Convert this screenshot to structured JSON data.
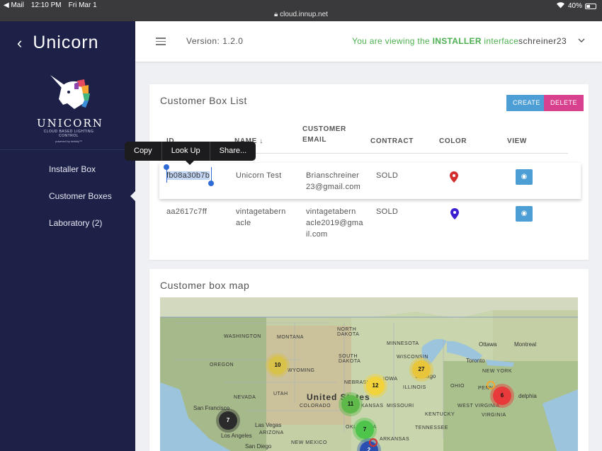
{
  "status_bar": {
    "back_app": "◀ Mail",
    "time": "12:10 PM",
    "date": "Fri Mar 1",
    "url": "cloud.innup.net",
    "battery": "40%",
    "battery_level": 0.4
  },
  "sidebar": {
    "app_name": "Unicorn",
    "logo_word": "UNICORN",
    "logo_tagline": "CLOUD BASED LIGHTING CONTROL",
    "logo_powered": "powered by twinkly™",
    "items": [
      {
        "label": "Installer Box"
      },
      {
        "label": "Customer Boxes"
      },
      {
        "label": "Laboratory (2)"
      }
    ]
  },
  "header": {
    "version": "Version: 1.2.0",
    "viewing_prefix": "You are viewing the ",
    "viewing_role": "INSTALLER",
    "viewing_suffix": " interface",
    "username": "schreiner23"
  },
  "box_list": {
    "title": "Customer Box List",
    "create_label": "CREATE",
    "delete_label": "DELETE",
    "columns": {
      "id": "ID",
      "name": "NAME",
      "email_line1": "CUSTOMER",
      "email_line2": "EMAIL",
      "contract": "CONTRACT",
      "color": "COLOR",
      "view": "VIEW"
    },
    "sort_icon": "arrow-down-icon",
    "rows": [
      {
        "id": "fb08a30b7b",
        "name": "Unicorn Test",
        "email_l1": "Brianschreiner",
        "email_l2": "23@gmail.com",
        "email_l3": "",
        "contract": "SOLD",
        "color": "#d32f2f"
      },
      {
        "id": "aa2617c7ff",
        "name": "vintagetabern",
        "name_l2": "acle",
        "email_l1": "vintagetabern",
        "email_l2": "acle2019@gma",
        "email_l3": "il.com",
        "contract": "SOLD",
        "color": "#3b1fd1"
      }
    ]
  },
  "context_menu": {
    "items": [
      "Copy",
      "Look Up",
      "Share..."
    ]
  },
  "map": {
    "title": "Customer box map",
    "labels": {
      "washington": "WASHINGTON",
      "montana": "MONTANA",
      "north_dakota_1": "NORTH",
      "north_dakota_2": "DAKOTA",
      "oregon": "OREGON",
      "wyoming": "WYOMING",
      "south_dakota_1": "SOUTH",
      "south_dakota_2": "DAKOTA",
      "minnesota": "MINNESOTA",
      "wisconsin": "WISCONSIN",
      "nevada": "NEVADA",
      "utah": "UTAH",
      "colorado": "COLORADO",
      "nebraska": "NEBRASKA",
      "iowa": "IOWA",
      "illinois": "ILLINOIS",
      "kansas": "KANSAS",
      "missouri": "MISSOURI",
      "ohio": "OHIO",
      "west_virginia": "WEST VIRGINIA",
      "virginia": "VIRGINIA",
      "kentucky": "KENTUCKY",
      "tennessee": "TENNESSEE",
      "oklahoma": "OKLAHOMA",
      "arkansas": "ARKANSAS",
      "arizona": "ARIZONA",
      "new_mexico": "NEW MEXICO",
      "new_york": "NEW YORK",
      "penn": "PENN",
      "united_states": "United States",
      "ottawa": "Ottawa",
      "montreal": "Montreal",
      "toronto": "Toronto",
      "chicago": "Chicago",
      "san_francisco": "San Francisco",
      "las_vegas": "Las Vegas",
      "los_angeles": "Los Angeles",
      "san_diego": "San Diego",
      "philadelphia": "delphia"
    },
    "clusters": [
      {
        "count": "10",
        "color": "#d8c24a"
      },
      {
        "count": "27",
        "color": "#e8c53a"
      },
      {
        "count": "12",
        "color": "#f2d33c"
      },
      {
        "count": "11",
        "color": "#5fb84a"
      },
      {
        "count": "6",
        "color": "#e83a3a"
      },
      {
        "count": "7",
        "color": "#2b2b2b"
      },
      {
        "count": "7",
        "color": "#4fc44a"
      },
      {
        "count": "2",
        "color": "#2a4fb0"
      }
    ]
  }
}
